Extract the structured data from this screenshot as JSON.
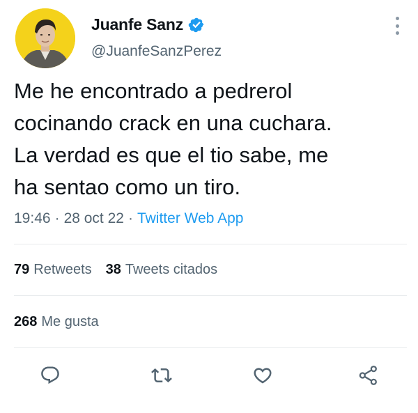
{
  "author": {
    "display_name": "Juanfe Sanz",
    "handle": "@JuanfeSanzPerez",
    "verified_icon": "verified-badge-icon",
    "avatar_bg": "#f4d21b"
  },
  "tweet": {
    "text": "Me he encontrado a pedrerol\ncocinando crack en una cuchara.\nLa verdad es que el tio sabe, me\nha sentao como un tiro.",
    "time": "19:46",
    "date": "28 oct 22",
    "separator": "·",
    "source": "Twitter Web App"
  },
  "stats": {
    "retweets_count": "79",
    "retweets_label": "Retweets",
    "quotes_count": "38",
    "quotes_label": "Tweets citados",
    "likes_count": "268",
    "likes_label": "Me gusta"
  },
  "actions": [
    "reply-icon",
    "retweet-icon",
    "like-icon",
    "share-icon"
  ],
  "colors": {
    "accent": "#1d9bf0",
    "text": "#0f1419",
    "muted": "#536471",
    "icon": "#536471",
    "divider": "#e7eaec"
  }
}
